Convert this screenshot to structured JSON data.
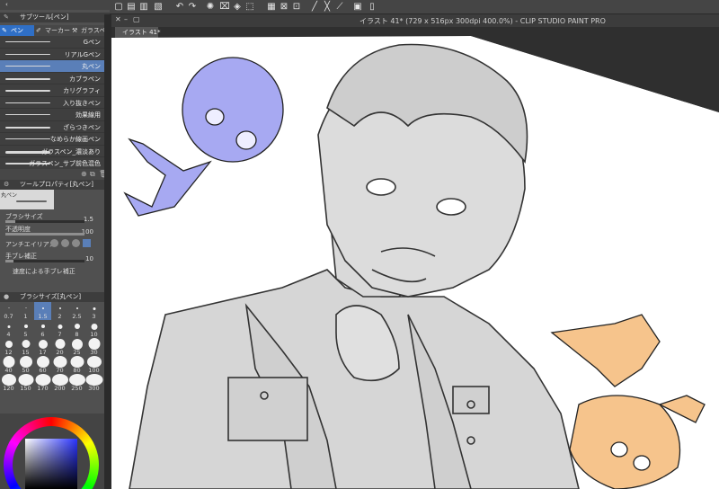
{
  "window": {
    "title": "イラスト 41* (729 x 516px 300dpi 400.0%) - CLIP STUDIO PAINT PRO"
  },
  "doc_tab": {
    "label": "イラスト 41*"
  },
  "subtool_panel": {
    "title": "サブツール[ペン]",
    "tabs": [
      "ペン",
      "マーカー",
      "ガラスペン"
    ],
    "brushes": [
      {
        "label": "Gペン"
      },
      {
        "label": "リアルGペン"
      },
      {
        "label": "丸ペン"
      },
      {
        "label": "カブラペン"
      },
      {
        "label": "カリグラフィ"
      },
      {
        "label": "入り抜きペン"
      },
      {
        "label": "効果線用"
      },
      {
        "label": "ざらつきペン"
      },
      {
        "label": "なめらか線画ペン"
      },
      {
        "label": "ガラスペン_濃淡あり"
      },
      {
        "label": "ガラスペン_サブ前色混色"
      }
    ],
    "selected_index": 2
  },
  "tool_property": {
    "title": "ツールプロパティ[丸ペン]",
    "preview_name": "丸ペン",
    "brush_size_label": "ブラシサイズ",
    "brush_size_value": "1.5",
    "opacity_label": "不透明度",
    "opacity_value": "100",
    "antialias_label": "アンチエイリアス",
    "stabilization_label": "手ブレ補正",
    "stabilization_value": "10",
    "speed_stabilization_label": "速度による手ブレ補正"
  },
  "brush_size_panel": {
    "title": "ブラシサイズ[丸ペン]",
    "sizes": [
      "0.7",
      "1",
      "1.5",
      "2",
      "2.5",
      "3",
      "4",
      "5",
      "6",
      "7",
      "8",
      "10",
      "12",
      "15",
      "17",
      "20",
      "25",
      "30",
      "40",
      "50",
      "60",
      "70",
      "80",
      "100",
      "120",
      "150",
      "170",
      "200",
      "250",
      "300"
    ],
    "selected_size": "1.5"
  },
  "colors": {
    "panel_bg": "#505050",
    "selection": "#5a7fb8",
    "accent": "#2f6fc6",
    "chibi_blue": "#a7a9f2",
    "chibi_orange": "#f6c48c"
  }
}
